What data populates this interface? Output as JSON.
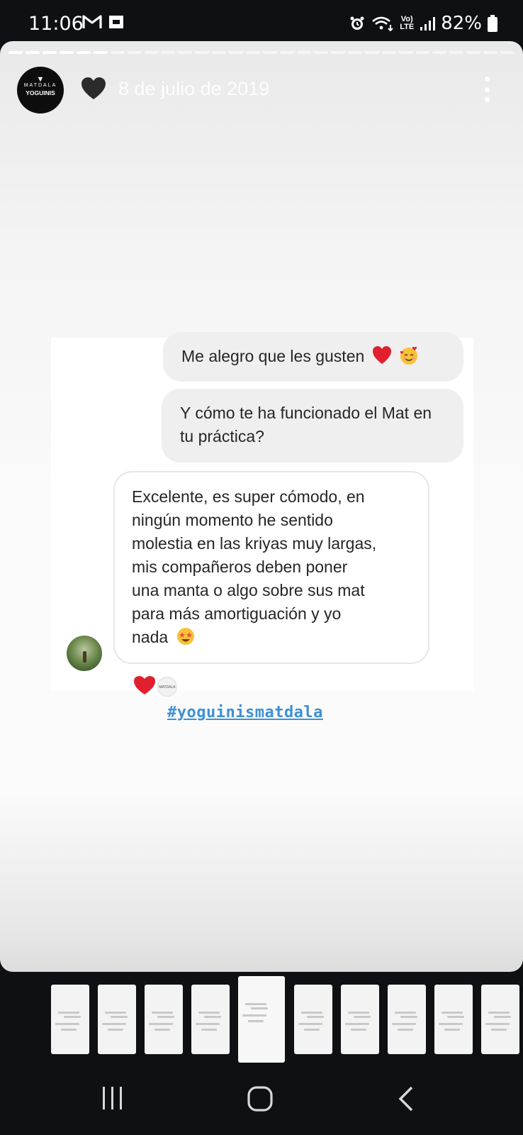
{
  "status_bar": {
    "time": "11:06",
    "battery": "82%",
    "network": "LTE"
  },
  "story": {
    "account_logo_top": "MATDALA",
    "account_logo_bottom": "YOGUINIS",
    "date": "8 de julio de 2019",
    "progress_total": 30,
    "progress_done": 6,
    "hashtag": "#yoguinismatdala"
  },
  "chat": {
    "messages": [
      {
        "text": "Me alegro que les gusten"
      },
      {
        "text": "Y cómo te ha funcionado el Mat en tu práctica?"
      },
      {
        "lines": [
          "Excelente, es super cómodo, en",
          "ningún momento he sentido",
          "molestia en las kriyas muy largas,",
          "mis compañeros deben poner",
          "una manta o algo sobre sus mat",
          "para más amortiguación y yo",
          "nada"
        ]
      }
    ],
    "reaction_avatar_text": "MATDALA"
  },
  "icons": {
    "story_heart": "black-heart-icon",
    "more": "more-vertical-icon"
  },
  "colors": {
    "hashtag": "#3d90d6",
    "heart": "#e0202f"
  }
}
